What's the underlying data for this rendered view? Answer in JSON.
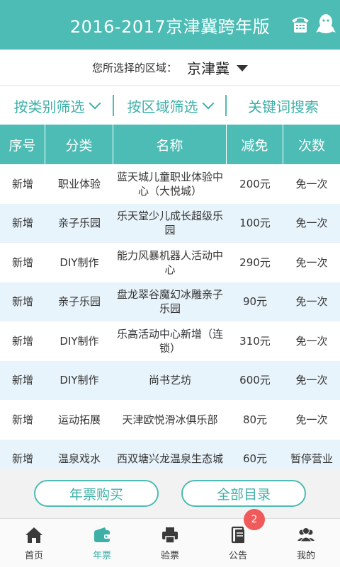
{
  "header": {
    "title": "2016-2017京津冀跨年版",
    "icons": [
      "phone-icon",
      "qq-icon"
    ]
  },
  "region": {
    "label": "您所选择的区域：",
    "value": "京津冀"
  },
  "filters": {
    "by_category": "按类别筛选",
    "by_area": "按区域筛选",
    "keyword_search": "关键词搜索"
  },
  "table": {
    "headers": [
      "序号",
      "分类",
      "名称",
      "减免",
      "次数"
    ],
    "rows": [
      [
        "新增",
        "职业体验",
        "蓝天城儿童职业体验中心（大悦城）",
        "200元",
        "免一次"
      ],
      [
        "新增",
        "亲子乐园",
        "乐天堂少儿成长超级乐园",
        "100元",
        "免一次"
      ],
      [
        "新增",
        "DIY制作",
        "能力风暴机器人活动中心",
        "290元",
        "免一次"
      ],
      [
        "新增",
        "亲子乐园",
        "盘龙翠谷魔幻冰雕亲子乐园",
        "90元",
        "免一次"
      ],
      [
        "新增",
        "DIY制作",
        "乐高活动中心新增（连锁）",
        "310元",
        "免一次"
      ],
      [
        "新增",
        "DIY制作",
        "尚书艺坊",
        "600元",
        "免一次"
      ],
      [
        "新增",
        "运动拓展",
        "天津欧悦滑冰俱乐部",
        "80元",
        "免一次"
      ],
      [
        "新增",
        "温泉戏水",
        "西双塘兴龙温泉生态城",
        "60元",
        "暂停营业"
      ]
    ]
  },
  "buttons": {
    "buy_ticket": "年票购买",
    "full_catalog": "全部目录"
  },
  "tabbar": {
    "items": [
      {
        "label": "首页",
        "icon": "home-icon"
      },
      {
        "label": "年票",
        "icon": "wallet-icon"
      },
      {
        "label": "验票",
        "icon": "printer-icon"
      },
      {
        "label": "公告",
        "icon": "notice-icon",
        "badge": "2"
      },
      {
        "label": "我的",
        "icon": "user-group-icon"
      }
    ],
    "active": "年票"
  },
  "colors": {
    "accent": "#4cbcb4",
    "row_alt": "#e8f4fb",
    "badge": "#f05a5a"
  }
}
